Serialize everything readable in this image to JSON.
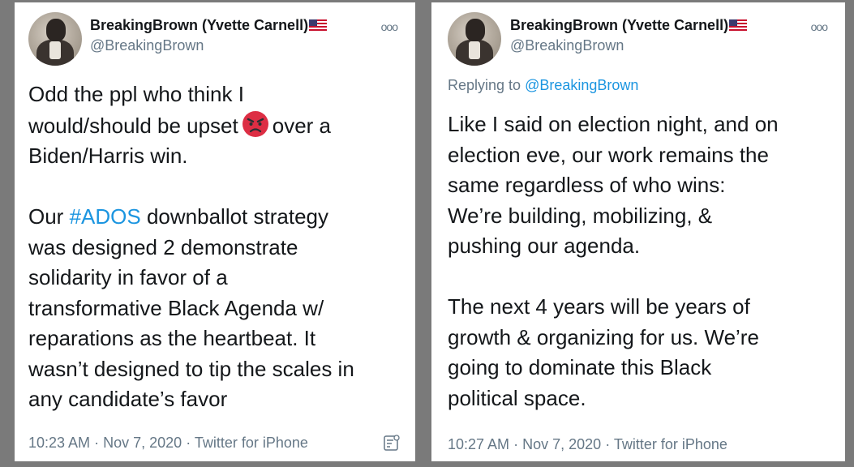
{
  "left_tweet": {
    "name": "BreakingBrown (Yvette Carnell)",
    "flag_icon": "us-flag",
    "handle": "@BreakingBrown",
    "more_icon": "more-options",
    "text_line1_pre": "Odd the ppl who think I\nwould/should be upset",
    "emoji": "angry-face",
    "text_line1_post": "over a\nBiden/Harris win.\n\nOur",
    "hashtag": "#ADOS",
    "text_rest": "downballot strategy\nwas designed 2 demonstrate\nsolidarity in favor of a\ntransformative Black Agenda w/\nreparations as the heartbeat. It\nwasn’t designed to tip the scales in\nany candidate’s favor",
    "time": "10:23 AM",
    "date": "Nov 7, 2020",
    "source": "Twitter for iPhone",
    "analytics_icon": "analytics-icon"
  },
  "right_tweet": {
    "name": "BreakingBrown (Yvette Carnell)",
    "flag_icon": "us-flag",
    "handle": "@BreakingBrown",
    "more_icon": "more-options",
    "replying_to_label": "Replying to",
    "replying_to_handle": "@BreakingBrown",
    "text": "Like I said on election night, and on\nelection eve, our work remains the\nsame regardless of who wins:\nWe’re building, mobilizing, &\npushing our agenda.\n\nThe next 4 years will be years of\ngrowth & organizing for us. We’re\ngoing to dominate this Black\npolitical space.",
    "time": "10:27 AM",
    "date": "Nov 7, 2020",
    "source": "Twitter for iPhone"
  },
  "separator": "·",
  "colors": {
    "link": "#1b95e0",
    "text": "#14171a",
    "secondary": "#657786",
    "background": "#7a7a7a"
  }
}
